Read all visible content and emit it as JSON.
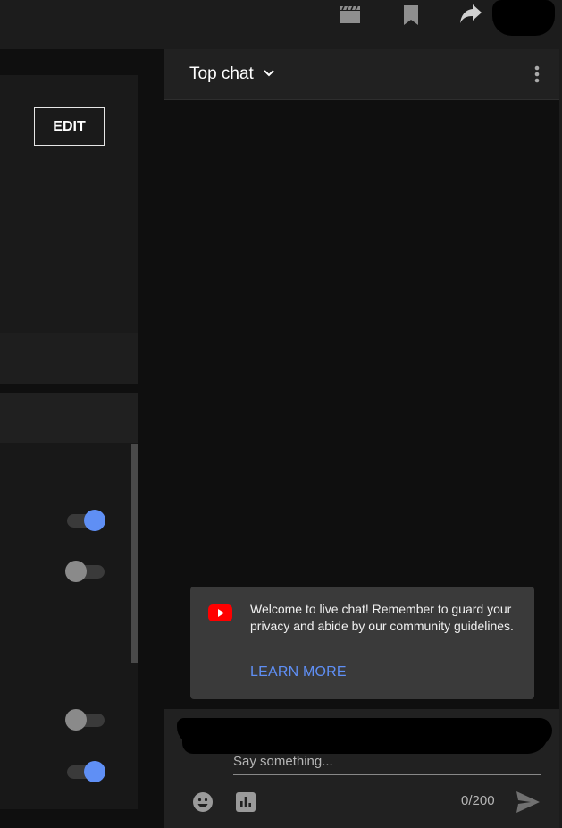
{
  "topbar": {
    "icons": [
      "clapperboard-icon",
      "bookmark-icon",
      "share-icon"
    ]
  },
  "left_panel": {
    "edit_label": "EDIT",
    "toggles": [
      true,
      false,
      false,
      true
    ]
  },
  "chat": {
    "title": "Top chat",
    "welcome": {
      "message": "Welcome to live chat! Remember to guard your privacy and abide by our community guidelines.",
      "link": "LEARN MORE"
    },
    "input": {
      "placeholder": "Say something...",
      "counter": "0/200"
    }
  },
  "colors": {
    "accent": "#5f8ff5",
    "youtube_red": "#ff0000",
    "background": "#0f0f0f",
    "panel": "#212121"
  }
}
